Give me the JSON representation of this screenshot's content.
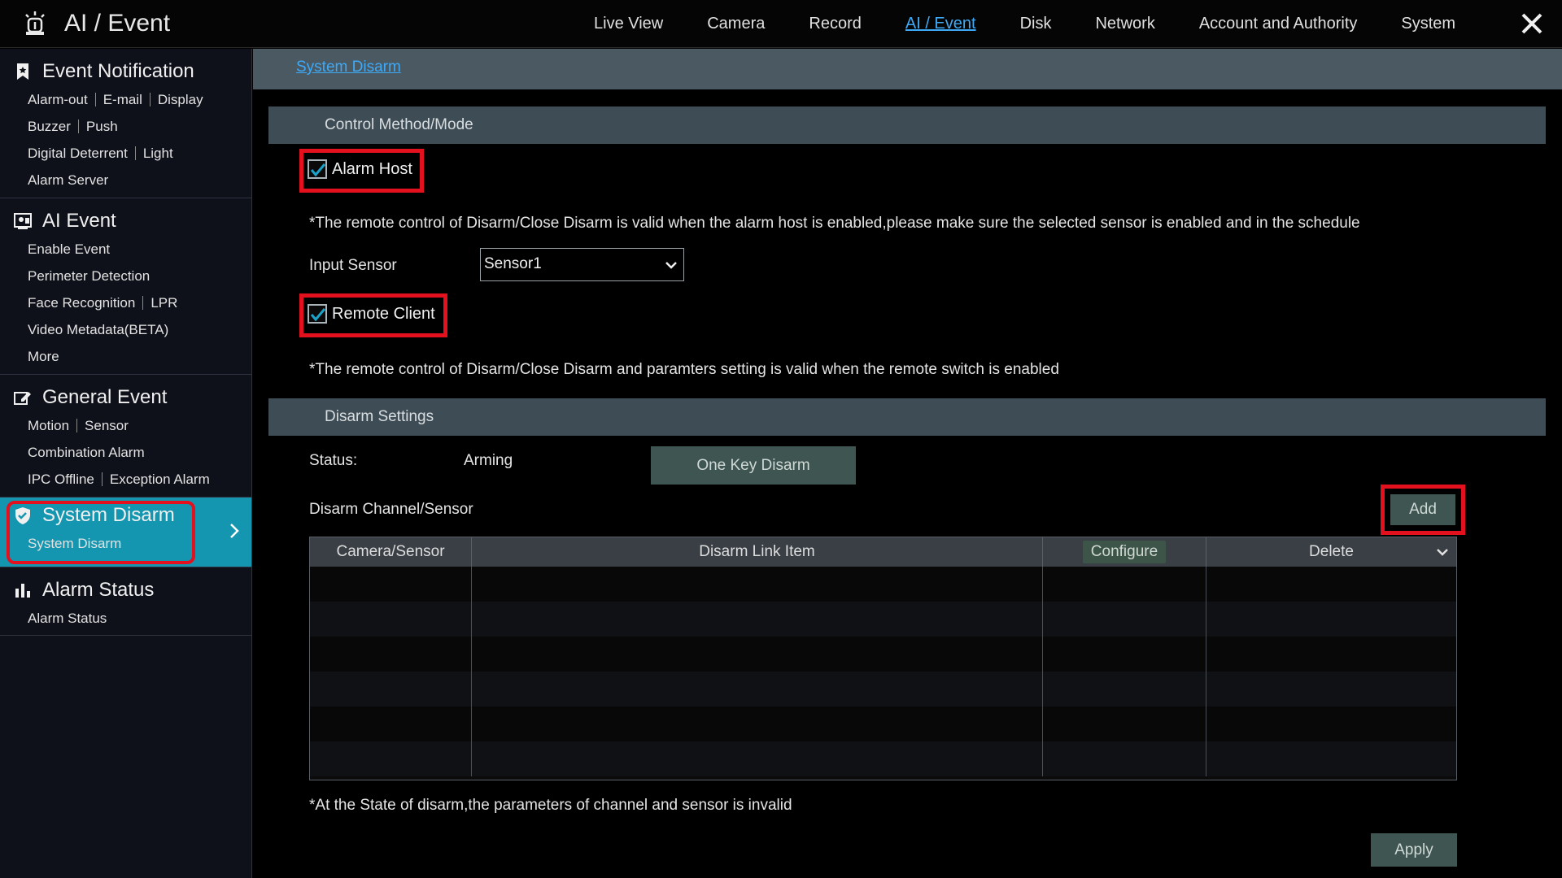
{
  "app": {
    "title": "AI / Event",
    "nav": [
      "Live View",
      "Camera",
      "Record",
      "AI / Event",
      "Disk",
      "Network",
      "Account and Authority",
      "System"
    ],
    "active_nav": "AI / Event"
  },
  "sidebar": {
    "groups": [
      {
        "title": "Event Notification",
        "icon": "bookmark-star-icon",
        "rows": [
          [
            "Alarm-out",
            "E-mail",
            "Display"
          ],
          [
            "Buzzer",
            "Push"
          ],
          [
            "Digital Deterrent",
            "Light"
          ],
          [
            "Alarm Server"
          ]
        ]
      },
      {
        "title": "AI Event",
        "icon": "ai-face-icon",
        "rows": [
          [
            "Enable Event"
          ],
          [
            "Perimeter Detection"
          ],
          [
            "Face Recognition",
            "LPR"
          ],
          [
            "Video Metadata(BETA)"
          ],
          [
            "More"
          ]
        ]
      },
      {
        "title": "General Event",
        "icon": "edit-event-icon",
        "rows": [
          [
            "Motion",
            "Sensor"
          ],
          [
            "Combination Alarm"
          ],
          [
            "IPC Offline",
            "Exception Alarm"
          ]
        ]
      },
      {
        "title": "System Disarm",
        "icon": "shield-icon",
        "rows": [
          [
            "System Disarm"
          ]
        ]
      },
      {
        "title": "Alarm Status",
        "icon": "bar-chart-icon",
        "rows": [
          [
            "Alarm Status"
          ]
        ]
      }
    ]
  },
  "main": {
    "breadcrumb": "System Disarm",
    "control_section_title": "Control Method/Mode",
    "alarm_host": {
      "label": "Alarm Host",
      "checked": true
    },
    "alarm_host_note": "*The remote control of Disarm/Close Disarm is valid when the alarm host is enabled,please make sure the selected sensor is enabled and in the schedule",
    "input_sensor": {
      "label": "Input Sensor",
      "value": "Sensor1"
    },
    "remote_client": {
      "label": "Remote Client",
      "checked": true
    },
    "remote_client_note": "*The remote control of Disarm/Close Disarm and paramters setting is valid when the remote switch is enabled",
    "disarm_section_title": "Disarm Settings",
    "status": {
      "label": "Status:",
      "value": "Arming"
    },
    "one_key_disarm_label": "One Key Disarm",
    "channel_sensor_label": "Disarm Channel/Sensor",
    "add_label": "Add",
    "table": {
      "columns": [
        "Camera/Sensor",
        "Disarm Link Item",
        "Configure",
        "Delete"
      ],
      "rows": []
    },
    "footer_note": "*At the State of disarm,the parameters of channel and sensor is invalid",
    "apply_label": "Apply"
  },
  "colors": {
    "accent": "#1496b1",
    "link": "#3fa9f5",
    "highlight": "#e3101e",
    "section_bar": "#3e4d55",
    "button": "#3f5551"
  }
}
